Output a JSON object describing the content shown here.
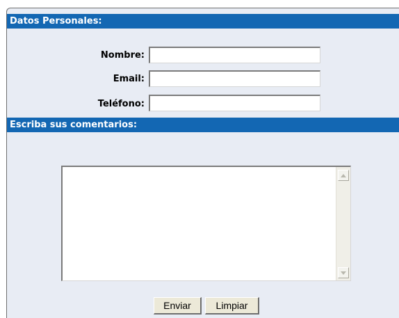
{
  "sections": {
    "personal_header": "Datos Personales:",
    "comments_header": "Escriba sus comentarios:"
  },
  "fields": {
    "nombre_label": "Nombre:",
    "nombre_value": "",
    "email_label": "Email:",
    "email_value": "",
    "telefono_label": "Teléfono:",
    "telefono_value": "",
    "comments_value": ""
  },
  "buttons": {
    "send_label": "Enviar",
    "clear_label": "Limpiar"
  },
  "colors": {
    "header_bg": "#1367b3",
    "panel_bg": "#e8ecf4",
    "button_bg": "#ece9d8"
  },
  "icons": {
    "scroll_up": "triangle-up-icon",
    "scroll_down": "triangle-down-icon"
  }
}
